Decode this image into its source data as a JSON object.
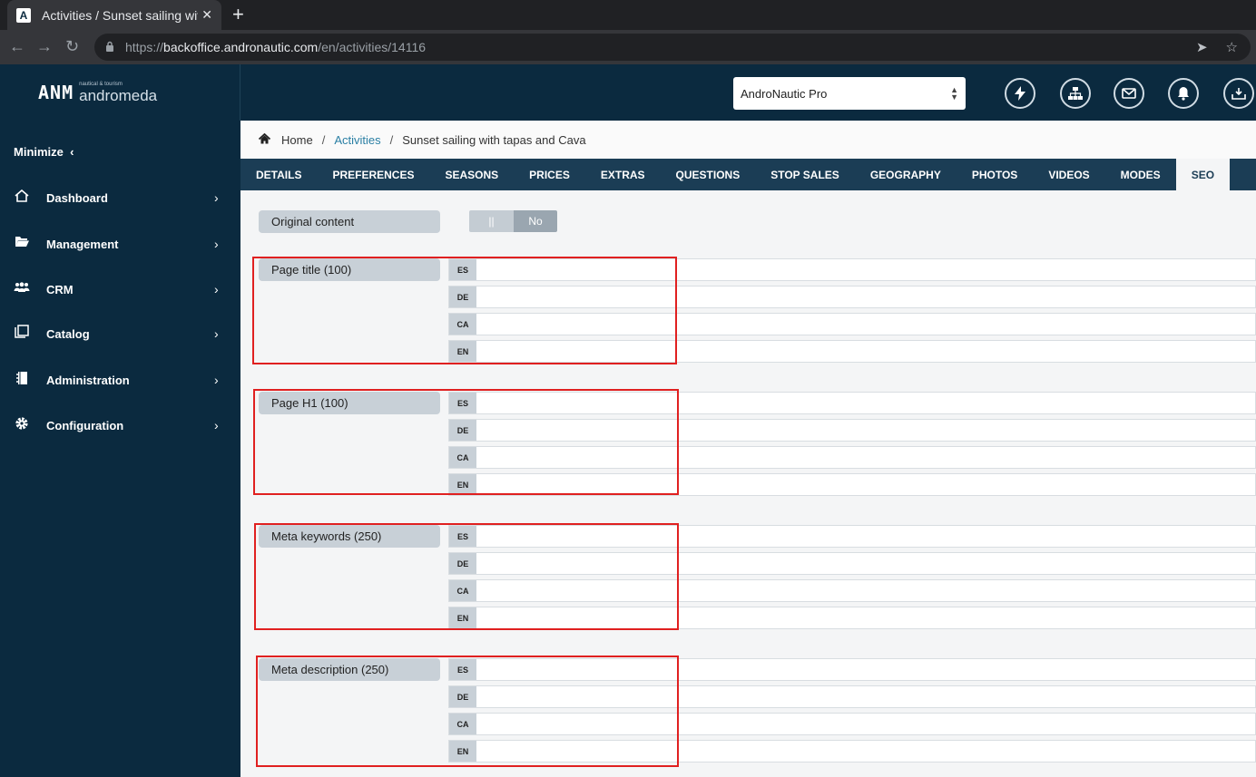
{
  "browser": {
    "tab_title": "Activities / Sunset sailing with tapas and Cava",
    "tab_close": "✕",
    "new_tab": "+",
    "url_prefix": "https://",
    "url_host": "backoffice.andronautic.com",
    "url_path": "/en/activities/14116"
  },
  "header": {
    "logo_mark": "ANM",
    "logo_sub": "nautical & tourism",
    "logo_name": "andromeda",
    "company": "AndroNautic Pro",
    "icons": [
      "lightning-icon",
      "network-icon",
      "mail-icon",
      "bell-icon",
      "inbox-download-icon"
    ]
  },
  "sidebar": {
    "minimize": "Minimize",
    "items": [
      {
        "label": "Dashboard",
        "icon": "home-icon"
      },
      {
        "label": "Management",
        "icon": "folder-open-icon"
      },
      {
        "label": "CRM",
        "icon": "users-icon"
      },
      {
        "label": "Catalog",
        "icon": "catalog-icon"
      },
      {
        "label": "Administration",
        "icon": "notebook-icon"
      },
      {
        "label": "Configuration",
        "icon": "gear-icon"
      }
    ]
  },
  "breadcrumb": {
    "home": "Home",
    "activities": "Activities",
    "current": "Sunset sailing with tapas and Cava"
  },
  "tabs": [
    "DETAILS",
    "PREFERENCES",
    "SEASONS",
    "PRICES",
    "EXTRAS",
    "QUESTIONS",
    "STOP SALES",
    "GEOGRAPHY",
    "PHOTOS",
    "VIDEOS",
    "MODES",
    "SEO"
  ],
  "active_tab": "SEO",
  "original_content": {
    "label": "Original content",
    "toggle_knob": "||",
    "toggle_value": "No"
  },
  "languages": [
    "ES",
    "DE",
    "CA",
    "EN"
  ],
  "fields": [
    {
      "label": "Page title (100)"
    },
    {
      "label": "Page H1 (100)"
    },
    {
      "label": "Meta keywords (250)"
    },
    {
      "label": "Meta description (250)"
    }
  ]
}
